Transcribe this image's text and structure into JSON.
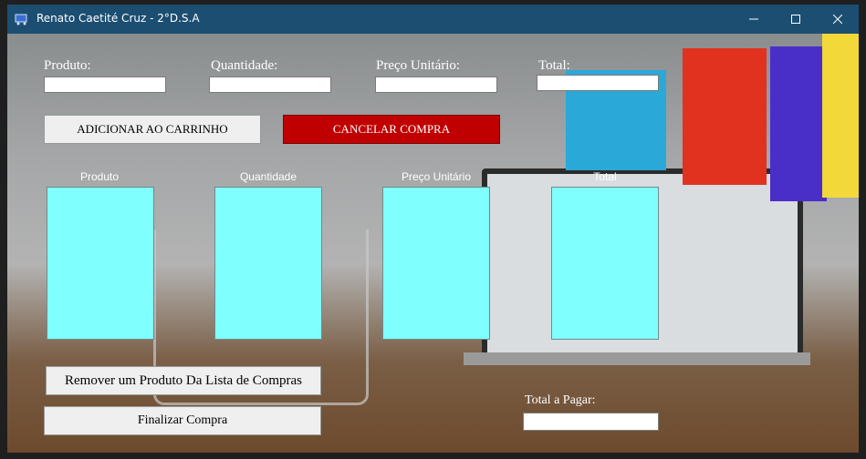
{
  "window": {
    "title": "Renato Caetité Cruz - 2°D.S.A"
  },
  "form": {
    "produto_label": "Produto:",
    "quantidade_label": "Quantidade:",
    "preco_label": "Preço Unitário:",
    "total_label": "Total:",
    "produto_value": "",
    "quantidade_value": "",
    "preco_value": "",
    "total_value": ""
  },
  "buttons": {
    "add_to_cart": "ADICIONAR AO CARRINHO",
    "cancel": "CANCELAR COMPRA",
    "remove": "Remover um Produto Da Lista de Compras",
    "finalize": "Finalizar Compra"
  },
  "lists": {
    "headers": [
      "Produto",
      "Quantidade",
      "Preço Unitário",
      "Total"
    ]
  },
  "footer": {
    "total_pagar_label": "Total a Pagar:",
    "total_pagar_value": ""
  },
  "colors": {
    "titlebar": "#1c4e72",
    "cancel_button": "#c00000",
    "listbox": "#80ffff"
  }
}
